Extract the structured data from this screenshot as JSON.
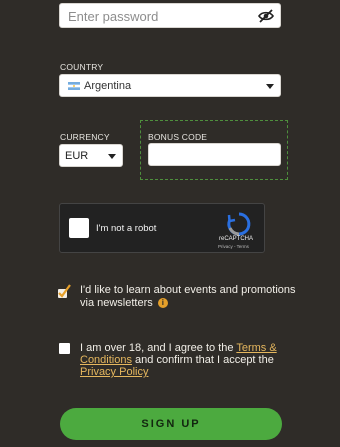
{
  "password": {
    "placeholder": "Enter password"
  },
  "country": {
    "label": "COUNTRY",
    "value": "Argentina"
  },
  "currency": {
    "label": "CURRENCY",
    "value": "EUR"
  },
  "bonus_code": {
    "label": "BONUS CODE",
    "value": ""
  },
  "captcha": {
    "text": "I'm not a robot",
    "brand": "reCAPTCHA",
    "links": "Privacy - Terms"
  },
  "newsletter": {
    "text": "I'd like to learn about events and promotions via newsletters",
    "info_glyph": "i"
  },
  "age_terms": {
    "prefix": "I am over 18, and I agree to the ",
    "terms_link": "Terms & Conditions",
    "middle": " and confirm that I accept the ",
    "privacy_link": "Privacy Policy"
  },
  "signup": {
    "label": "SIGN UP"
  },
  "colors": {
    "background": "#2f2c28",
    "accent_green": "#4caa3f",
    "link": "#e5b75e",
    "info": "#e6a02a"
  }
}
